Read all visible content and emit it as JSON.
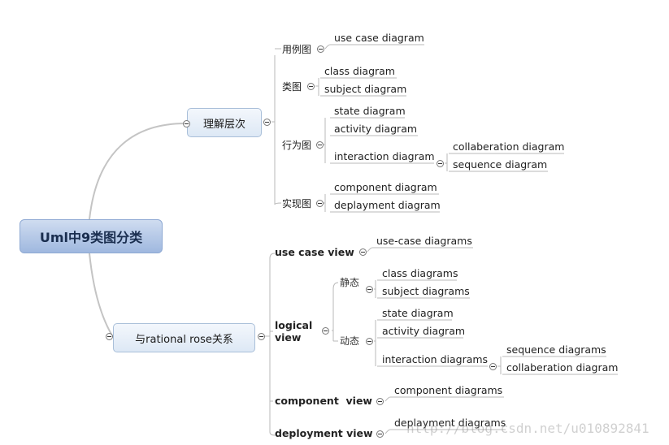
{
  "root": "Uml中9类图分类",
  "branch_top": "理解层次",
  "branch_bottom": "与rational rose关系",
  "top": {
    "usecase": {
      "label": "用例图",
      "items": [
        "use case diagram"
      ]
    },
    "class": {
      "label": "类图",
      "items": [
        "class diagram",
        "subject diagram"
      ]
    },
    "behavior": {
      "label": "行为图",
      "items": [
        "state diagram",
        "activity diagram",
        "interaction diagram"
      ],
      "interaction": [
        "collaberation diagram",
        "sequence diagram"
      ]
    },
    "impl": {
      "label": "实现图",
      "items": [
        "component diagram",
        "deplayment diagram"
      ]
    }
  },
  "bottom": {
    "usecase_view": {
      "label": "use case view",
      "items": [
        "use-case diagrams"
      ]
    },
    "logical_view": {
      "label": "logical view",
      "static": {
        "label": "静态",
        "items": [
          "class diagrams",
          "subject diagrams"
        ]
      },
      "dynamic": {
        "label": "动态",
        "items": [
          "state diagram",
          "activity diagram",
          "interaction diagrams"
        ],
        "interaction": [
          "sequence diagrams",
          "collaberation diagram"
        ]
      }
    },
    "component_view": {
      "label": "component  view",
      "items": [
        "component diagrams"
      ]
    },
    "deployment_view": {
      "label": "deployment view",
      "items": [
        "deplayment diagrams"
      ]
    }
  },
  "watermark": "http://blog.csdn.net/u010892841"
}
